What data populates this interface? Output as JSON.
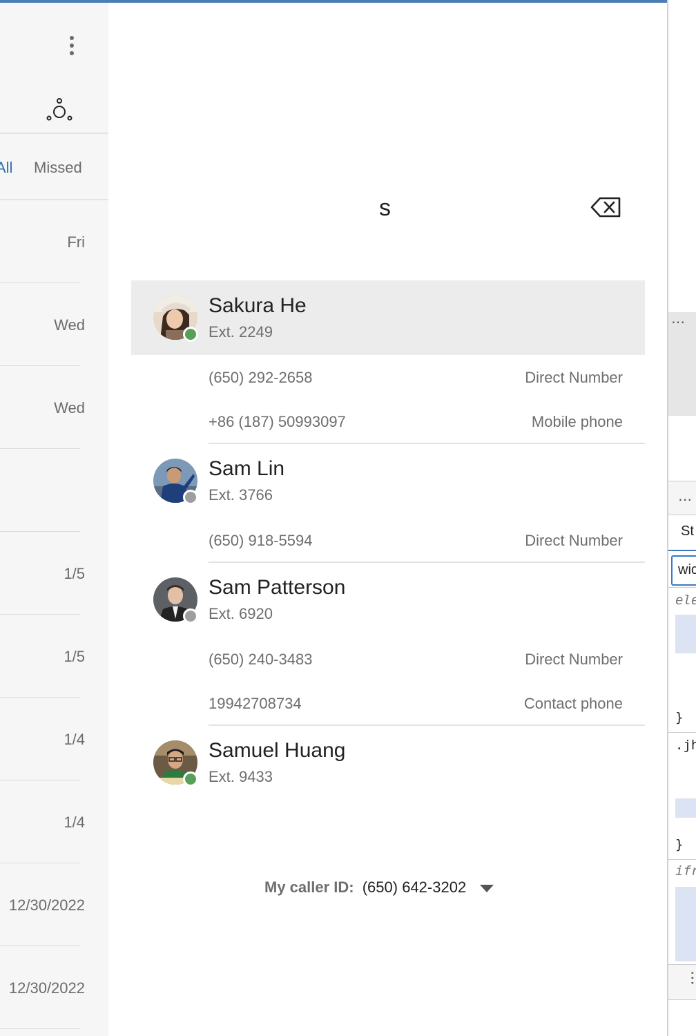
{
  "history": {
    "tabs": {
      "all": "All",
      "missed": "Missed"
    },
    "dates": [
      "Fri",
      "Wed",
      "Wed",
      "",
      "1/5",
      "1/5",
      "1/4",
      "1/4",
      "12/30/2022",
      "12/30/2022"
    ]
  },
  "dialer": {
    "search_value": "s",
    "contacts": [
      {
        "name": "Sakura He",
        "ext": "Ext. 2249",
        "presence": "available",
        "phones": [
          {
            "number": "(650) 292-2658",
            "type": "Direct Number"
          },
          {
            "number": "+86 (187) 50993097",
            "type": "Mobile phone"
          }
        ]
      },
      {
        "name": "Sam Lin",
        "ext": "Ext. 3766",
        "presence": "offline",
        "phones": [
          {
            "number": "(650) 918-5594",
            "type": "Direct Number"
          }
        ]
      },
      {
        "name": "Sam Patterson",
        "ext": "Ext. 6920",
        "presence": "offline",
        "phones": [
          {
            "number": "(650) 240-3483",
            "type": "Direct Number"
          },
          {
            "number": "19942708734",
            "type": "Contact phone"
          }
        ]
      },
      {
        "name": "Samuel Huang",
        "ext": "Ext. 9433",
        "presence": "available",
        "phones": []
      }
    ],
    "caller_id": {
      "label": "My caller ID:",
      "number": "(650) 642-3202"
    }
  },
  "devtools": {
    "tab_label": "St",
    "filter_value": "wic",
    "lines": [
      "ele",
      "}",
      ".jh",
      "}",
      "ifr"
    ]
  },
  "colors": {
    "accent": "#2f6fb0",
    "presence_available": "#56a05a",
    "presence_offline": "#9e9e9e",
    "highlight_row": "#ececec"
  }
}
